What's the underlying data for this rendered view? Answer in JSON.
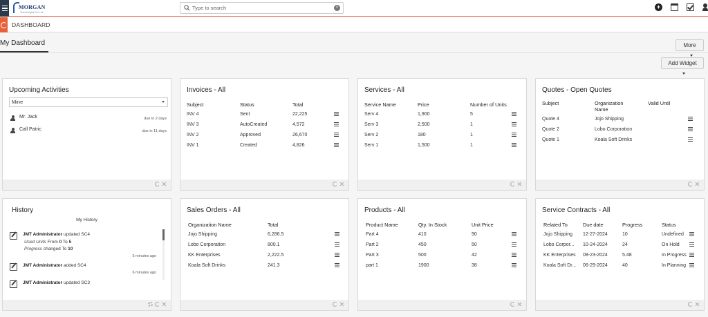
{
  "topbar": {
    "logo_text": "MORGAN",
    "logo_sub": "Technologies Pvt. Ltd.",
    "search_placeholder": "Type to search"
  },
  "subbar": {
    "title": "DASHBOARD"
  },
  "tab": {
    "label": "My Dashboard"
  },
  "buttons": {
    "more": "More",
    "add_widget": "Add Widget"
  },
  "widgets": {
    "upcoming": {
      "title": "Upcoming Activities",
      "filter": "Mine",
      "items": [
        {
          "name": "Mr. Jack",
          "due": "due in 2 days"
        },
        {
          "name": "Call Patric",
          "due": "due in 11 days"
        }
      ]
    },
    "invoices": {
      "title": "Invoices - All",
      "headers": [
        "Subject",
        "Status",
        "Total"
      ],
      "rows": [
        [
          "INV 4",
          "Sent",
          "22,225"
        ],
        [
          "INV 3",
          "AutoCreated",
          "4,572"
        ],
        [
          "INV 2",
          "Approved",
          "26,670"
        ],
        [
          "INV 1",
          "Created",
          "4,826"
        ]
      ]
    },
    "services": {
      "title": "Services - All",
      "headers": [
        "Service Name",
        "Price",
        "Number of Units"
      ],
      "rows": [
        [
          "Serv 4",
          "1,900",
          "5"
        ],
        [
          "Serv 3",
          "2,500",
          "1"
        ],
        [
          "Serv 2",
          "180",
          "1"
        ],
        [
          "Serv 1",
          "1,500",
          "1"
        ]
      ]
    },
    "quotes": {
      "title": "Quotes - Open Quotes",
      "headers": [
        "Subject",
        "Organization Name",
        "Valid Until"
      ],
      "rows": [
        [
          "Quote 4",
          "Jojo Shipping",
          ""
        ],
        [
          "Quote 2",
          "Lobo Corporation",
          ""
        ],
        [
          "Quote 1",
          "Koala Soft Drinks",
          ""
        ]
      ]
    },
    "history": {
      "title": "History",
      "subtitle": "My History",
      "items": [
        {
          "user": "JMT Administrator",
          "action": "updated SC4",
          "detail1_label": "Used Units",
          "detail1_pre": "From",
          "detail1_from": "0",
          "detail1_mid": "To",
          "detail1_to": "5",
          "detail2_label": "Progress",
          "detail2_pre": "changed To",
          "detail2_to": "10",
          "ago": "5 minutes ago"
        },
        {
          "user": "JMT Administrator",
          "action": "added SC4",
          "ago": "6 minutes ago"
        },
        {
          "user": "JMT Administrator",
          "action": "updated SC3"
        }
      ]
    },
    "sales_orders": {
      "title": "Sales Orders - All",
      "headers": [
        "Organization Name",
        "Total"
      ],
      "rows": [
        [
          "Jojo Shipping",
          "6,286.5"
        ],
        [
          "Lobo Corporation",
          "800.1"
        ],
        [
          "KK Enterprises",
          "2,222.5"
        ],
        [
          "Koala Soft Drinks",
          "241.3"
        ]
      ]
    },
    "products": {
      "title": "Products - All",
      "headers": [
        "Product Name",
        "Qty. In Stock",
        "Unit Price"
      ],
      "rows": [
        [
          "Part 4",
          "410",
          "90"
        ],
        [
          "Part 2",
          "450",
          "50"
        ],
        [
          "Part 3",
          "500",
          "42"
        ],
        [
          "part 1",
          "1900",
          "38"
        ]
      ]
    },
    "service_contracts": {
      "title": "Service Contracts - All",
      "headers": [
        "Related To",
        "Due date",
        "Progress",
        "Status"
      ],
      "rows": [
        [
          "Jojo Shipping",
          "12-27-2024",
          "10",
          "Undefined"
        ],
        [
          "Lobo Corpor...",
          "10-24-2024",
          "24",
          "On Hold"
        ],
        [
          "KK Enterprises",
          "08-23-2024",
          "5.48",
          "In Progress"
        ],
        [
          "Koala Soft Dr...",
          "06-29-2024",
          "40",
          "In Planning"
        ]
      ]
    }
  }
}
